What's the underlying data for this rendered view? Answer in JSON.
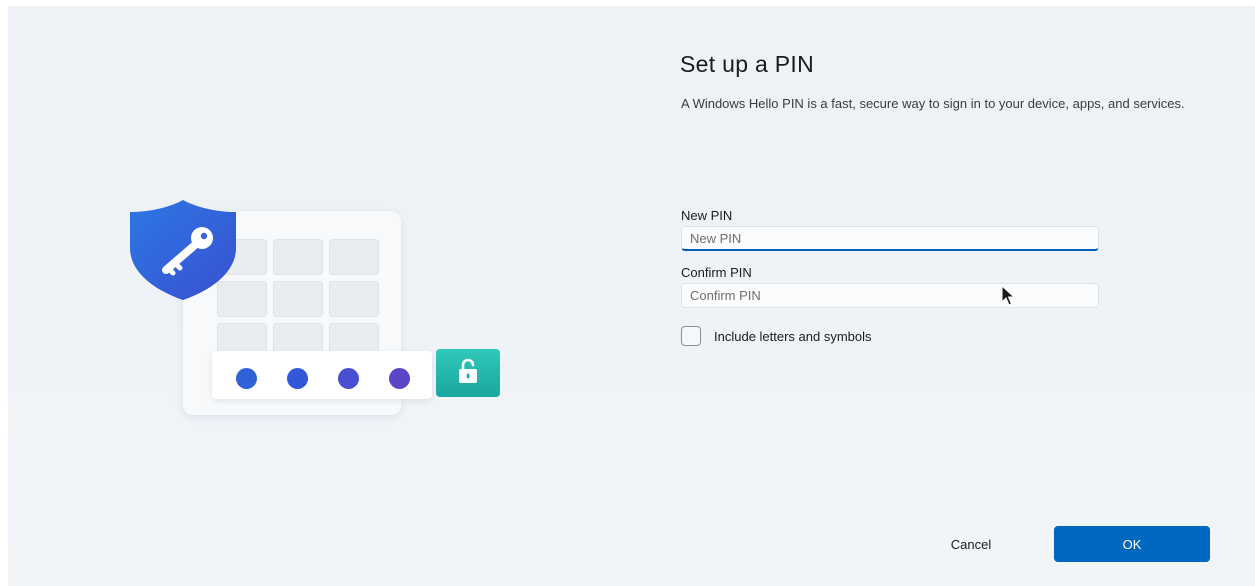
{
  "dialog": {
    "title": "Set up a PIN",
    "description": "A Windows Hello PIN is a fast, secure way to sign in to your device, apps, and services."
  },
  "fields": {
    "new_pin": {
      "label": "New PIN",
      "placeholder": "New PIN",
      "value": "",
      "focused": true
    },
    "confirm_pin": {
      "label": "Confirm PIN",
      "placeholder": "Confirm PIN",
      "value": ""
    }
  },
  "options": {
    "include_letters_label": "Include letters and symbols",
    "include_letters_checked": false
  },
  "buttons": {
    "cancel_label": "Cancel",
    "ok_label": "OK"
  },
  "illustration": {
    "pin_dot_colors": [
      "#2f62d8",
      "#3158d6",
      "#4a4fd2",
      "#5b46c8"
    ],
    "unlock_tile_color": "#22b5ab",
    "shield_color": "#2f5fd6",
    "icons": [
      "shield-key-icon",
      "unlock-icon"
    ]
  },
  "colors": {
    "accent": "#0067c0",
    "background": "#eff3f7"
  }
}
